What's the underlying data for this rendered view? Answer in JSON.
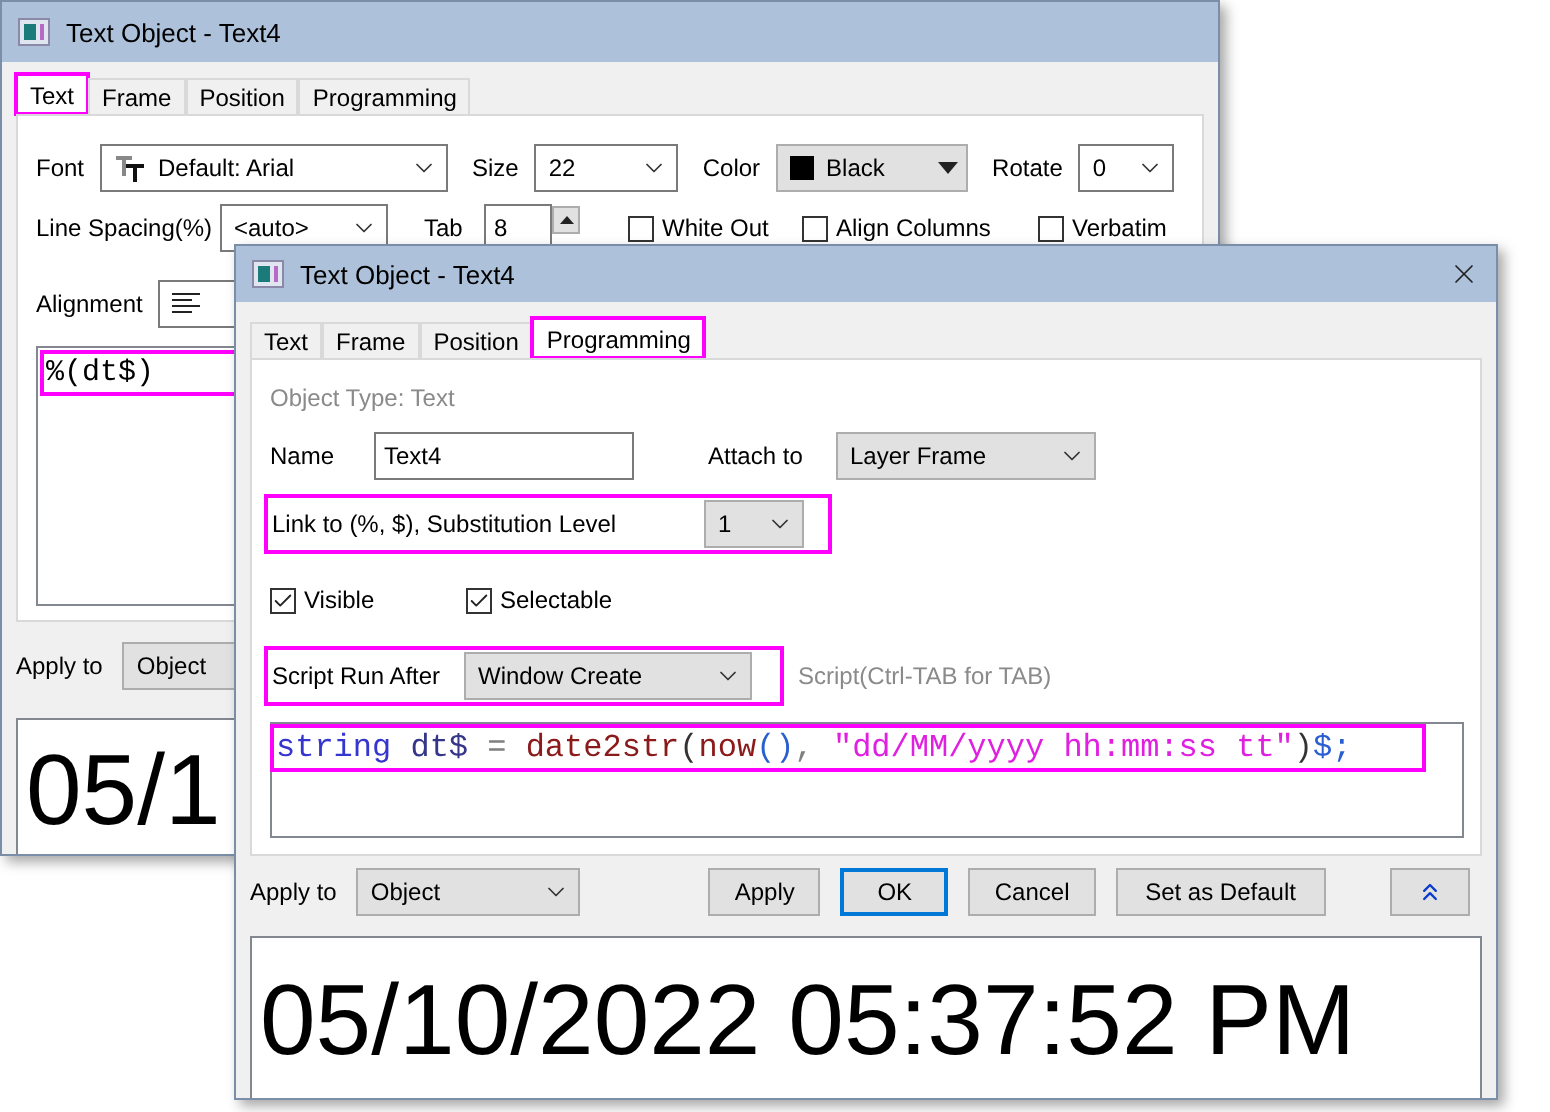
{
  "back_window": {
    "title": "Text Object - Text4",
    "tabs": [
      {
        "label": "Text",
        "selected": true,
        "highlighted": true
      },
      {
        "label": "Frame",
        "selected": false,
        "highlighted": false
      },
      {
        "label": "Position",
        "selected": false,
        "highlighted": false
      },
      {
        "label": "Programming",
        "selected": false,
        "highlighted": false
      }
    ],
    "font": {
      "label": "Font",
      "value": "Default: Arial"
    },
    "size": {
      "label": "Size",
      "value": "22"
    },
    "color": {
      "label": "Color",
      "value": "Black",
      "color": "#000000"
    },
    "rotate": {
      "label": "Rotate",
      "value": "0"
    },
    "line_spacing": {
      "label": "Line Spacing(%)",
      "value": "<auto>"
    },
    "tab": {
      "label": "Tab",
      "value": "8"
    },
    "options": [
      {
        "label": "White Out",
        "checked": false
      },
      {
        "label": "Align Columns",
        "checked": false
      },
      {
        "label": "Verbatim",
        "checked": false
      }
    ],
    "alignment": {
      "label": "Alignment"
    },
    "text_content": {
      "value": "%(dt$)",
      "highlighted": true
    },
    "apply_to": {
      "label": "Apply to",
      "value": "Object"
    },
    "preview": "05/1"
  },
  "front_window": {
    "title": "Text Object - Text4",
    "tabs": [
      {
        "label": "Text",
        "selected": false,
        "highlighted": false
      },
      {
        "label": "Frame",
        "selected": false,
        "highlighted": false
      },
      {
        "label": "Position",
        "selected": false,
        "highlighted": false
      },
      {
        "label": "Programming",
        "selected": true,
        "highlighted": true
      }
    ],
    "object_type": "Object Type: Text",
    "name": {
      "label": "Name",
      "value": "Text4"
    },
    "attach_to": {
      "label": "Attach to",
      "value": "Layer Frame"
    },
    "link": {
      "label": "Link to (%, $), Substitution Level",
      "value": "1",
      "highlighted": true
    },
    "checkboxes": [
      {
        "label": "Visible",
        "checked": true
      },
      {
        "label": "Selectable",
        "checked": true
      }
    ],
    "script_run_after": {
      "label": "Script Run After",
      "value": "Window Create",
      "highlighted": true
    },
    "script_hint": "Script(Ctrl-TAB for TAB)",
    "script": {
      "highlighted": true,
      "tokens": [
        {
          "text": "string ",
          "kind": "keyword"
        },
        {
          "text": "dt$ ",
          "kind": "variable"
        },
        {
          "text": "= ",
          "kind": "operator"
        },
        {
          "text": "date2str",
          "kind": "function"
        },
        {
          "text": "(",
          "kind": "punct"
        },
        {
          "text": "now",
          "kind": "function"
        },
        {
          "text": "()",
          "kind": "bracket"
        },
        {
          "text": ", ",
          "kind": "operator"
        },
        {
          "text": "\"dd/MM/yyyy hh:mm:ss tt\"",
          "kind": "string"
        },
        {
          "text": ")",
          "kind": "punct"
        },
        {
          "text": "$;",
          "kind": "bracket"
        }
      ]
    },
    "apply_to": {
      "label": "Apply to",
      "value": "Object"
    },
    "buttons": [
      {
        "label": "Apply",
        "default": false
      },
      {
        "label": "OK",
        "default": true
      },
      {
        "label": "Cancel",
        "default": false
      },
      {
        "label": "Set as Default",
        "default": false
      }
    ],
    "preview": "05/10/2022 05:37:52 PM"
  }
}
